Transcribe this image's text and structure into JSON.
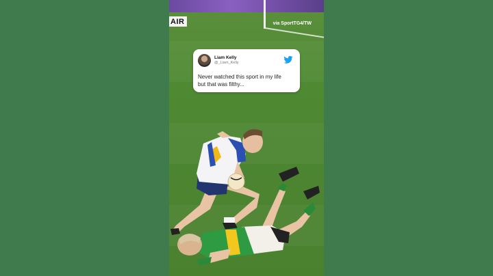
{
  "overlay": {
    "credit": "via SportTG4/TW",
    "scoreboard_fragment": "AIR"
  },
  "tweet": {
    "name": "Liam Kelly",
    "handle": "@_Liam_Kelly",
    "text_line1": "Never watched this sport in my life",
    "text_line2": "but that was filthy...",
    "icon": "twitter-bird-icon",
    "accent": "#1da1f2"
  },
  "colors": {
    "background": "#3f7b4d",
    "pitch": "#4f8a33"
  }
}
